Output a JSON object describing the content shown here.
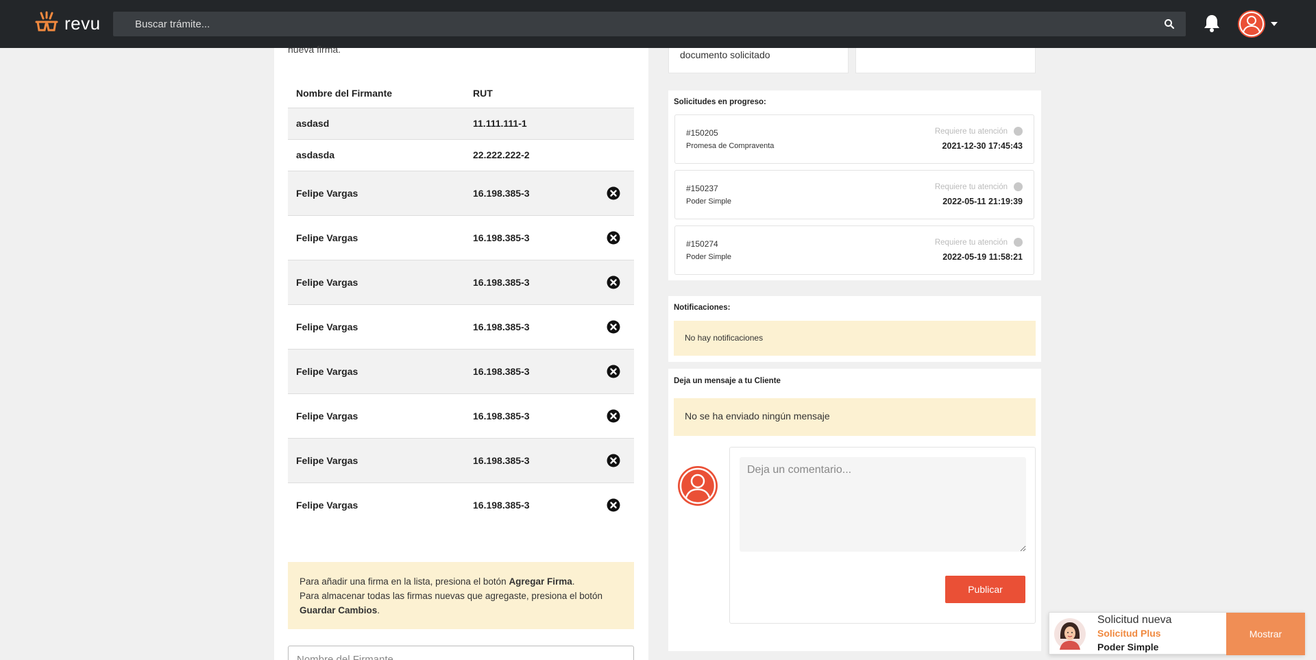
{
  "header": {
    "logo_text": "revu",
    "search_placeholder": "Buscar trámite..."
  },
  "left": {
    "intro_text": "nueva firma.",
    "table": {
      "headers": [
        "Nombre del Firmante",
        "RUT"
      ],
      "rows": [
        {
          "name": "asdasd",
          "rut": "11.111.111-1",
          "deletable": false
        },
        {
          "name": "asdasda",
          "rut": "22.222.222-2",
          "deletable": false
        },
        {
          "name": "Felipe Vargas",
          "rut": "16.198.385-3",
          "deletable": true
        },
        {
          "name": "Felipe Vargas",
          "rut": "16.198.385-3",
          "deletable": true
        },
        {
          "name": "Felipe Vargas",
          "rut": "16.198.385-3",
          "deletable": true
        },
        {
          "name": "Felipe Vargas",
          "rut": "16.198.385-3",
          "deletable": true
        },
        {
          "name": "Felipe Vargas",
          "rut": "16.198.385-3",
          "deletable": true
        },
        {
          "name": "Felipe Vargas",
          "rut": "16.198.385-3",
          "deletable": true
        },
        {
          "name": "Felipe Vargas",
          "rut": "16.198.385-3",
          "deletable": true
        },
        {
          "name": "Felipe Vargas",
          "rut": "16.198.385-3",
          "deletable": true
        }
      ]
    },
    "info": {
      "line1_prefix": "Para añadir una firma en la lista, presiona el botón ",
      "line1_bold": "Agregar Firma",
      "line1_suffix": ".",
      "line2_prefix": "Para almacenar todas las firmas nuevas que agregaste, presiona el botón ",
      "line2_bold": "Guardar Cambios",
      "line2_suffix": "."
    },
    "name_input_placeholder": "Nombre del Firmante"
  },
  "right": {
    "doc_label": "documento solicitado",
    "progress": {
      "title": "Solicitudes en progreso:",
      "items": [
        {
          "id": "#150205",
          "type": "Promesa de Compraventa",
          "status": "Requiere tu atención",
          "date": "2021-12-30 17:45:43"
        },
        {
          "id": "#150237",
          "type": "Poder Simple",
          "status": "Requiere tu atención",
          "date": "2022-05-11 21:19:39"
        },
        {
          "id": "#150274",
          "type": "Poder Simple",
          "status": "Requiere tu atención",
          "date": "2022-05-19 11:58:21"
        }
      ]
    },
    "notifications": {
      "title": "Notificaciones:",
      "empty": "No hay notificaciones"
    },
    "messages": {
      "title": "Deja un mensaje a tu Cliente",
      "empty": "No se ha enviado ningún mensaje",
      "comment_placeholder": "Deja un comentario...",
      "publish_label": "Publicar"
    }
  },
  "toast": {
    "title": "Solicitud nueva",
    "subtitle": "Solicitud Plus",
    "item": "Poder Simple",
    "button": "Mostrar"
  },
  "colors": {
    "topbar": "#232629",
    "accent": "#ea5036",
    "logo_orange": "#f0893f",
    "note_bg": "#fcf1d2",
    "toast_button": "#f08e55"
  }
}
